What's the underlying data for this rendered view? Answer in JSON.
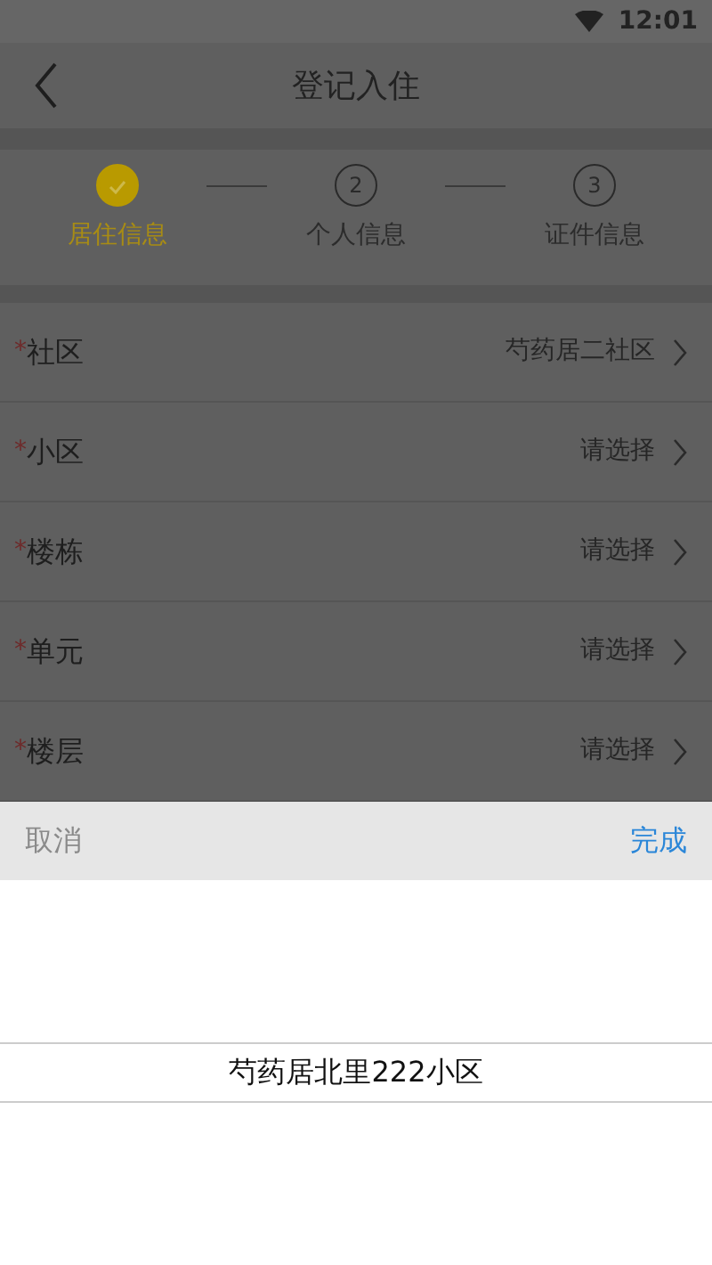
{
  "status_bar": {
    "time": "12:01"
  },
  "header": {
    "title": "登记入住"
  },
  "steps": [
    {
      "label": "居住信息",
      "done": true
    },
    {
      "label": "个人信息",
      "number": "2",
      "done": false
    },
    {
      "label": "证件信息",
      "number": "3",
      "done": false
    }
  ],
  "fields": [
    {
      "marker": "*",
      "label": "社区",
      "value": "芍药居二社区"
    },
    {
      "marker": "*",
      "label": "小区",
      "value": "请选择"
    },
    {
      "marker": "*",
      "label": "楼栋",
      "value": "请选择"
    },
    {
      "marker": "*",
      "label": "单元",
      "value": "请选择"
    },
    {
      "marker": "*",
      "label": "楼层",
      "value": "请选择"
    }
  ],
  "picker": {
    "cancel": "取消",
    "confirm": "完成",
    "options": [
      {
        "label": "芍药居北里222小区",
        "selected": true
      }
    ]
  }
}
